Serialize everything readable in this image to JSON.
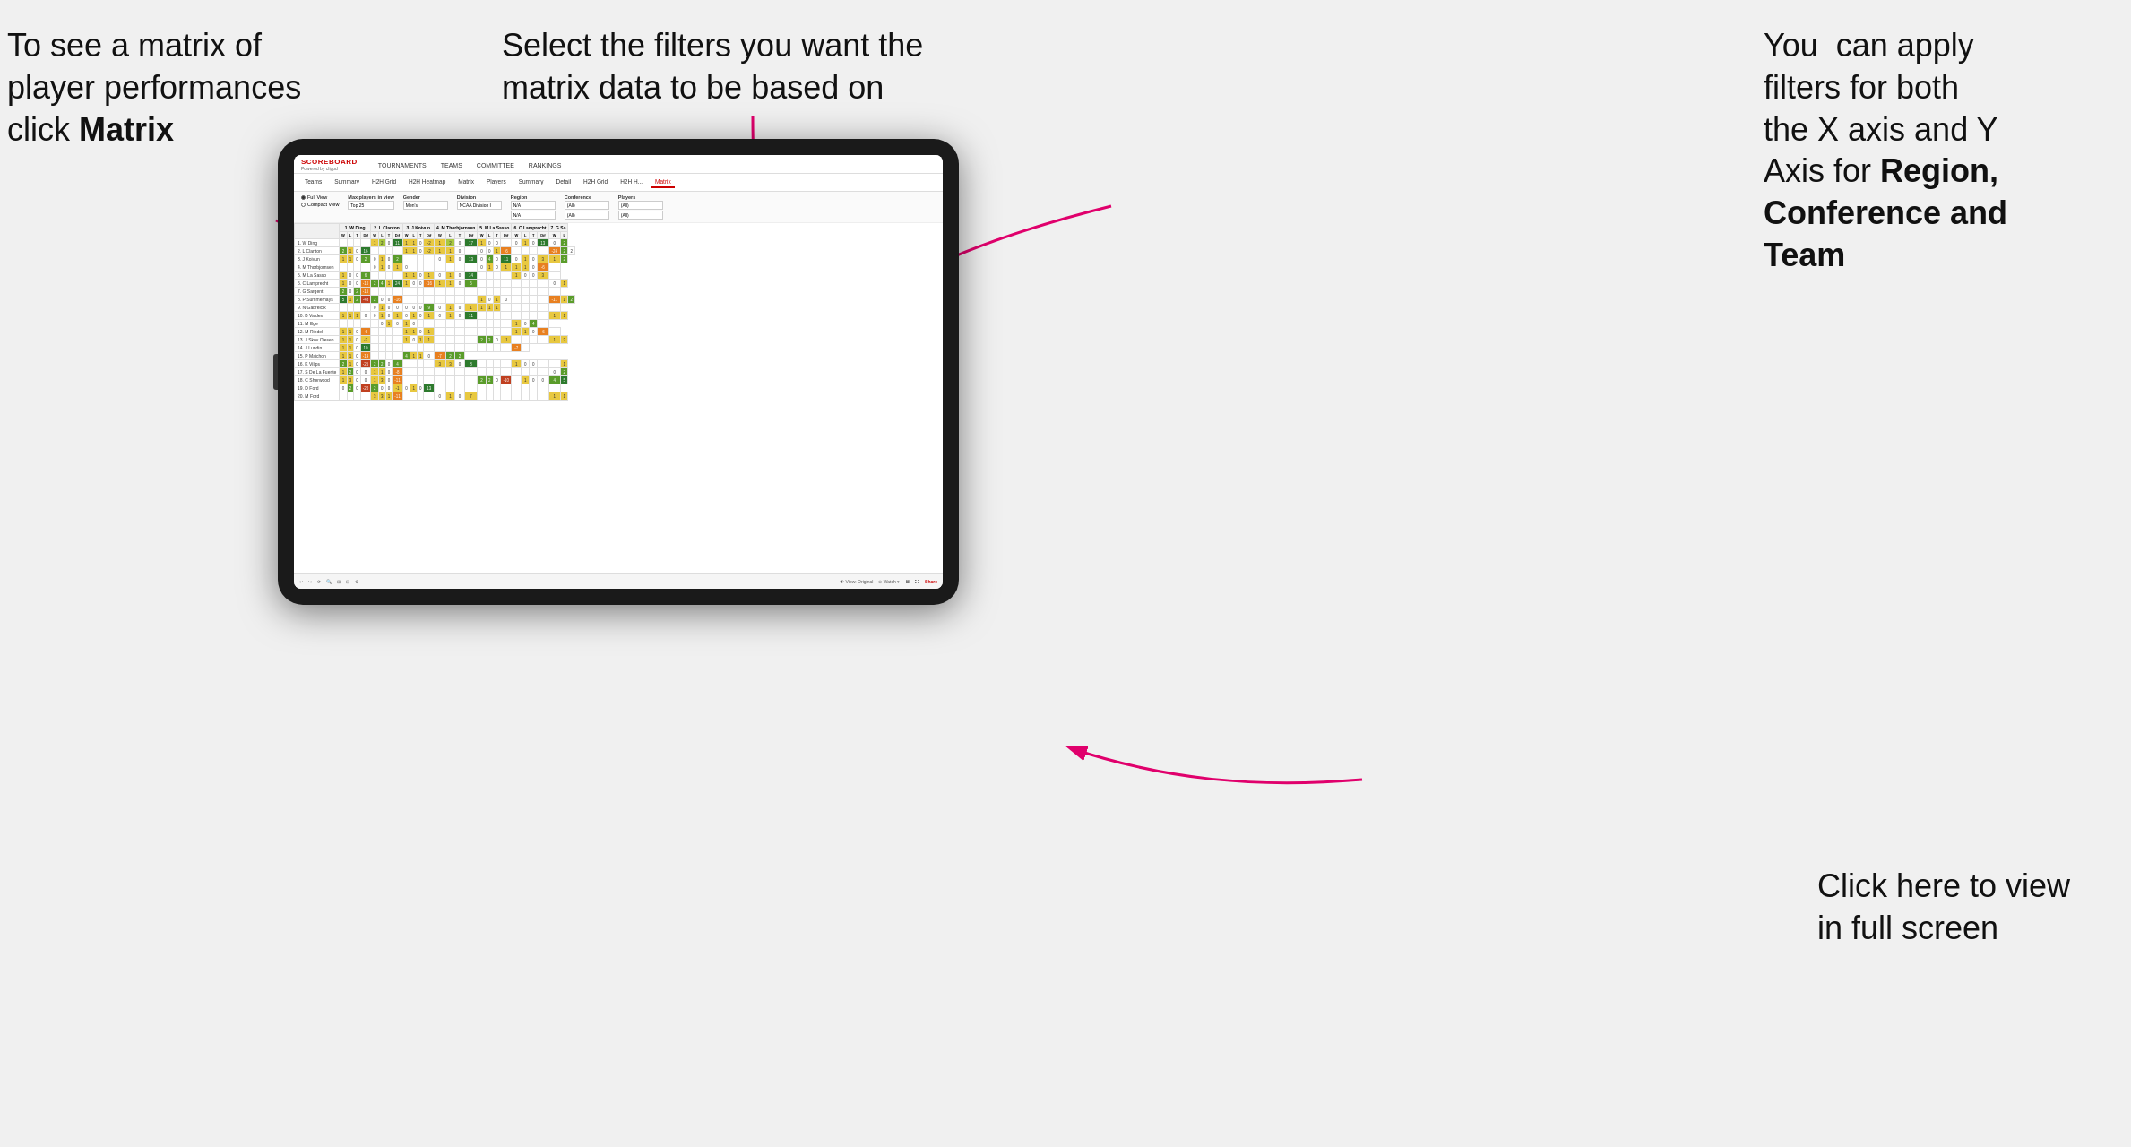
{
  "annotations": {
    "top_left": {
      "line1": "To see a matrix of",
      "line2": "player performances",
      "line3_prefix": "click ",
      "line3_bold": "Matrix"
    },
    "top_center": {
      "line1": "Select the filters you want the",
      "line2": "matrix data to be based on"
    },
    "top_right": {
      "line1": "You  can apply",
      "line2": "filters for both",
      "line3": "the X axis and Y",
      "line4_prefix": "Axis for ",
      "line4_bold": "Region,",
      "line5_bold": "Conference and",
      "line6_bold": "Team"
    },
    "bottom_right": {
      "line1": "Click here to view",
      "line2": "in full screen"
    }
  },
  "nav": {
    "logo": "SCOREBOARD",
    "logo_sub": "Powered by clippd",
    "items": [
      "TOURNAMENTS",
      "TEAMS",
      "COMMITTEE",
      "RANKINGS"
    ]
  },
  "sub_nav": {
    "items": [
      "Teams",
      "Summary",
      "H2H Grid",
      "H2H Heatmap",
      "Matrix",
      "Players",
      "Summary",
      "Detail",
      "H2H Grid",
      "H2H H...",
      "Matrix"
    ],
    "active": "Matrix"
  },
  "filters": {
    "view_options": [
      "Full View",
      "Compact View"
    ],
    "active_view": "Full View",
    "max_players_label": "Max players in view",
    "max_players_value": "Top 25",
    "gender_label": "Gender",
    "gender_value": "Men's",
    "division_label": "Division",
    "division_value": "NCAA Division I",
    "region_label": "Region",
    "region_value": "N/A",
    "region_value2": "N/A",
    "conference_label": "Conference",
    "conference_value": "(All)",
    "conference_value2": "(All)",
    "players_label": "Players",
    "players_value": "(All)",
    "players_value2": "(All)"
  },
  "matrix": {
    "col_headers": [
      "1. W Ding",
      "2. L Clanton",
      "3. J Koivun",
      "4. M Thorbjornsen",
      "5. M La Sasso",
      "6. C Lamprecht",
      "7. G Sa"
    ],
    "sub_headers": [
      "W",
      "L",
      "T",
      "Dif"
    ],
    "rows": [
      {
        "name": "1. W Ding",
        "cells": [
          "",
          "",
          "",
          "",
          "1",
          "2",
          "0",
          "11",
          "1",
          "1",
          "0",
          "-2",
          "1",
          "2",
          "0",
          "17",
          "1",
          "0",
          "0",
          "",
          "0",
          "1",
          "0",
          "13",
          "0",
          "2"
        ]
      },
      {
        "name": "2. L Clanton",
        "cells": [
          "2",
          "1",
          "0",
          "16",
          "",
          "",
          "",
          "",
          "1",
          "1",
          "0",
          "-2",
          "1",
          "1",
          "0",
          "",
          "0",
          "0",
          "1",
          "-6",
          "",
          "",
          "",
          "",
          "-24",
          "2",
          "2"
        ]
      },
      {
        "name": "3. J Koivun",
        "cells": [
          "1",
          "1",
          "0",
          "2",
          "0",
          "1",
          "0",
          "2",
          "",
          "",
          "",
          "",
          "0",
          "1",
          "0",
          "13",
          "0",
          "4",
          "0",
          "11",
          "0",
          "1",
          "0",
          "3",
          "1",
          "2"
        ]
      },
      {
        "name": "4. M Thorbjornsen",
        "cells": [
          "",
          "",
          "",
          "",
          "0",
          "1",
          "0",
          "1",
          "0",
          "",
          "",
          "",
          "",
          "",
          "",
          "",
          "0",
          "1",
          "0",
          "1",
          "1",
          "1",
          "0",
          "-6",
          ""
        ]
      },
      {
        "name": "5. M La Sasso",
        "cells": [
          "1",
          "0",
          "0",
          "6",
          "",
          "",
          "",
          "",
          "1",
          "1",
          "0",
          "1",
          "0",
          "1",
          "0",
          "14",
          "",
          "",
          "",
          "",
          "1",
          "0",
          "0",
          "3",
          ""
        ]
      },
      {
        "name": "6. C Lamprecht",
        "cells": [
          "1",
          "0",
          "0",
          "-16",
          "2",
          "4",
          "1",
          "24",
          "1",
          "0",
          "0",
          "-16",
          "1",
          "1",
          "0",
          "6",
          "",
          "",
          "",
          "",
          "",
          "",
          "",
          "",
          "0",
          "1"
        ]
      },
      {
        "name": "7. G Sargent",
        "cells": [
          "2",
          "0",
          "2",
          "-15",
          "",
          "",
          "",
          "",
          "",
          "",
          "",
          "",
          "",
          "",
          "",
          "",
          "",
          "",
          "",
          "",
          "",
          "",
          "",
          "",
          ""
        ]
      },
      {
        "name": "8. P Summerhays",
        "cells": [
          "5",
          "1",
          "2",
          "-48",
          "2",
          "0",
          "0",
          "-16",
          "",
          "",
          "",
          "",
          "",
          "",
          "",
          "",
          "1",
          "0",
          "1",
          "0",
          "",
          "",
          "",
          "",
          "-11",
          "1",
          "2"
        ]
      },
      {
        "name": "9. N Gabrelcik",
        "cells": [
          "",
          "",
          "",
          "",
          "0",
          "1",
          "0",
          "0",
          "0",
          "0",
          "0",
          "9",
          "0",
          "1",
          "0",
          "1",
          "1",
          "1",
          "1",
          "",
          "",
          "",
          "",
          "",
          ""
        ]
      },
      {
        "name": "10. B Valdes",
        "cells": [
          "1",
          "1",
          "1",
          "0",
          "0",
          "1",
          "0",
          "1",
          "0",
          "1",
          "0",
          "1",
          "0",
          "1",
          "0",
          "11",
          "",
          "",
          "",
          "",
          "",
          "",
          "",
          "",
          "1",
          "1"
        ]
      },
      {
        "name": "11. M Ege",
        "cells": [
          "",
          "",
          "",
          "",
          "",
          "0",
          "1",
          "0",
          "1",
          "0",
          "",
          "",
          "",
          "",
          "",
          "",
          "",
          "",
          "",
          "",
          "1",
          "0",
          "4",
          ""
        ]
      },
      {
        "name": "12. M Riedel",
        "cells": [
          "1",
          "1",
          "0",
          "-6",
          "",
          "",
          "",
          "",
          "1",
          "1",
          "0",
          "1",
          "",
          "",
          "",
          "",
          "",
          "",
          "",
          "",
          "1",
          "1",
          "0",
          "-6",
          ""
        ]
      },
      {
        "name": "13. J Skov Olesen",
        "cells": [
          "1",
          "1",
          "0",
          "-3",
          "",
          "",
          "",
          "",
          "1",
          "0",
          "1",
          "1",
          "",
          "",
          "",
          "",
          "2",
          "2",
          "0",
          "-1",
          "",
          "",
          "",
          "",
          "1",
          "3"
        ]
      },
      {
        "name": "14. J Lundin",
        "cells": [
          "1",
          "1",
          "0",
          "10",
          "",
          "",
          "",
          "",
          "",
          "",
          "",
          "",
          "",
          "",
          "",
          "",
          "",
          "",
          "",
          "",
          "-7",
          ""
        ]
      },
      {
        "name": "15. P Maichon",
        "cells": [
          "1",
          "1",
          "0",
          "-19",
          "",
          "",
          "",
          "",
          "4",
          "1",
          "1",
          "0",
          "-7",
          "2",
          "2"
        ]
      },
      {
        "name": "16. K Vilips",
        "cells": [
          "2",
          "1",
          "0",
          "-25",
          "2",
          "2",
          "0",
          "4",
          "",
          "",
          "",
          "",
          "3",
          "3",
          "0",
          "8",
          "",
          "",
          "",
          "",
          "1",
          "0",
          "0",
          "",
          "",
          "1"
        ]
      },
      {
        "name": "17. S De La Fuente",
        "cells": [
          "1",
          "2",
          "0",
          "0",
          "1",
          "1",
          "0",
          "-8",
          "",
          "",
          "",
          "",
          "",
          "",
          "",
          "",
          "",
          "",
          "",
          "",
          "",
          "",
          "",
          "",
          "0",
          "2"
        ]
      },
      {
        "name": "18. C Sherwood",
        "cells": [
          "1",
          "3",
          "0",
          "0",
          "1",
          "3",
          "0",
          "-11",
          "",
          "",
          "",
          "",
          "",
          "",
          "",
          "",
          "2",
          "2",
          "0",
          "-10",
          "",
          "1",
          "0",
          "0",
          "4",
          "5"
        ]
      },
      {
        "name": "19. D Ford",
        "cells": [
          "0",
          "2",
          "0",
          "-20",
          "2",
          "0",
          "0",
          "-1",
          "0",
          "1",
          "0",
          "13",
          "",
          "",
          "",
          "",
          "",
          "",
          "",
          "",
          "",
          "",
          "",
          "",
          ""
        ]
      },
      {
        "name": "20. M Ford",
        "cells": [
          "",
          "",
          "",
          "",
          "3",
          "3",
          "1",
          "-11",
          "",
          "",
          "",
          "",
          "0",
          "1",
          "0",
          "7",
          "",
          "",
          "",
          "",
          "",
          "",
          "",
          "",
          "1",
          "1"
        ]
      }
    ]
  },
  "bottom_bar": {
    "items": [
      "↩",
      "↪",
      "⟳",
      "🔍",
      "⊞+",
      "⊟",
      "🔧",
      "View: Original",
      "👁 Watch ▾",
      "🖥",
      "⛶",
      "Share"
    ]
  }
}
